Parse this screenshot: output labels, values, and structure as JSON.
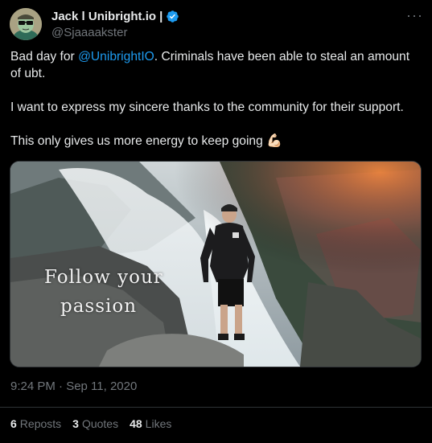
{
  "author": {
    "name": "Jack l Unibright.io |",
    "handle": "@Sjaaaakster",
    "verified": true,
    "verified_color": "#1d9bf0"
  },
  "tweet": {
    "para1_prefix": "Bad day for ",
    "mention": "@UnibrightIO",
    "para1_suffix": ". Criminals have been able to steal an amount of ubt.",
    "para2": "I want to express my sincere thanks to the community for their support.",
    "para3": "This only gives us more energy to keep going",
    "emoji": "💪🏻"
  },
  "media": {
    "overlay_line1": "Follow your",
    "overlay_line2": "passion"
  },
  "timestamp": "9:24 PM · Sep 11, 2020",
  "stats": {
    "reposts_count": "6",
    "reposts_label": "Reposts",
    "quotes_count": "3",
    "quotes_label": "Quotes",
    "likes_count": "48",
    "likes_label": "Likes"
  },
  "icons": {
    "more": "more-horizontal-icon",
    "verified": "verified-badge-icon"
  },
  "colors": {
    "background": "#000000",
    "text": "#e7e9ea",
    "secondary": "#71767b",
    "link": "#1d9bf0"
  }
}
